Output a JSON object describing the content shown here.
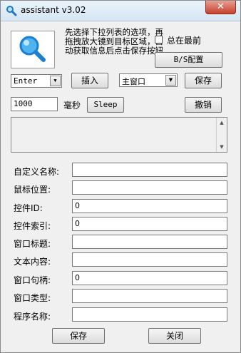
{
  "window": {
    "title": "assistant v3.02",
    "close_label": "✕"
  },
  "logo": {
    "icon": "magnifier-icon"
  },
  "hint_text": "先选择下拉列表的选项，再拖拽放大镜到目标区域，自动获取信息后点击保存按钮",
  "topmost": {
    "label": "总在最前",
    "checked": false
  },
  "bs_button": "B/S配置",
  "key_select": {
    "value": "Enter"
  },
  "insert_button": "插入",
  "window_select": {
    "value": "主窗口"
  },
  "save_top_button": "保存",
  "delay": {
    "value": "1000",
    "unit": "毫秒"
  },
  "sleep_button": "Sleep",
  "undo_button": "撤销",
  "fields": [
    {
      "label": "自定义名称:",
      "value": ""
    },
    {
      "label": "鼠标位置:",
      "value": ""
    },
    {
      "label": "控件ID:",
      "value": "0"
    },
    {
      "label": "控件索引:",
      "value": "0"
    },
    {
      "label": "窗口标题:",
      "value": ""
    },
    {
      "label": "文本内容:",
      "value": ""
    },
    {
      "label": "窗口句柄:",
      "value": "0"
    },
    {
      "label": "窗口类型:",
      "value": ""
    },
    {
      "label": "程序名称:",
      "value": ""
    }
  ],
  "footer": {
    "save_label": "保存",
    "close_label": "关闭"
  }
}
